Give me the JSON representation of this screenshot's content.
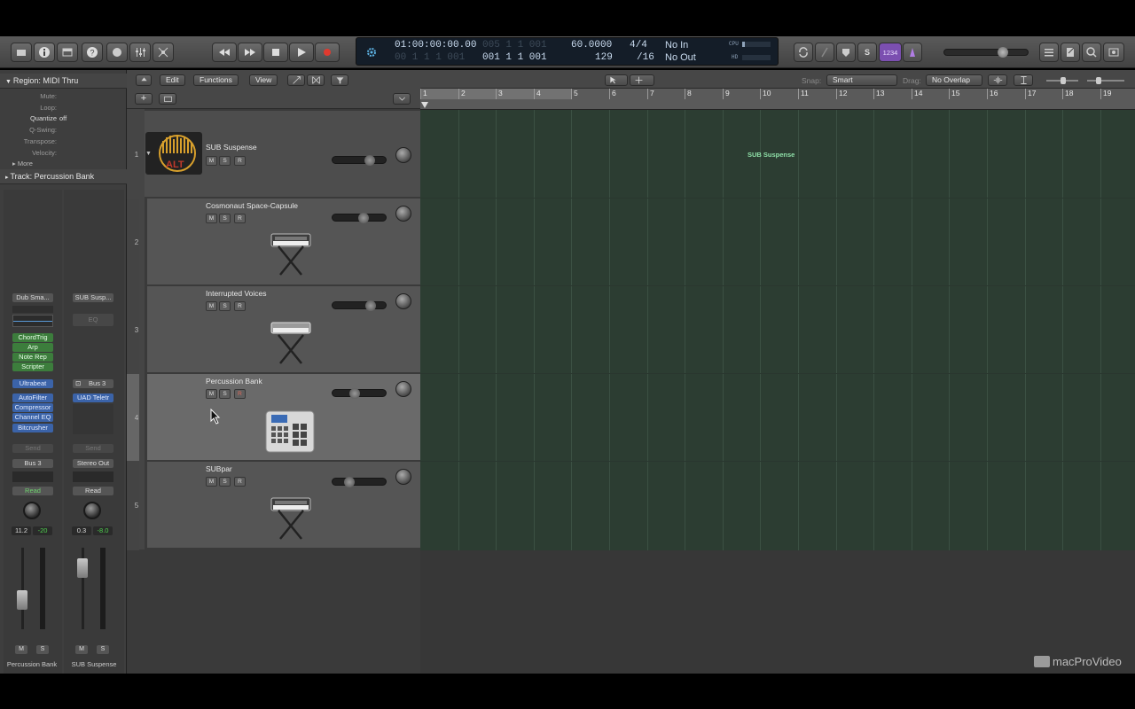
{
  "toolbar": {
    "lcd": {
      "position_time": "01:00:00:00.00",
      "position_time_dim": "00 1 1 1 001",
      "position_bars": "001 1 1 001",
      "position_bars_dim": "005 1 1 001",
      "tempo": "60.0000",
      "tempo_below": "129",
      "signature": "4/4",
      "division": "/16",
      "midi_in": "No In",
      "midi_out": "No Out",
      "cpu_label": "CPU",
      "hd_label": "HD"
    },
    "count_in_label": "1234"
  },
  "inspector": {
    "region_header": "Region: MIDI Thru",
    "params": [
      {
        "label": "Mute:",
        "value": ""
      },
      {
        "label": "Loop:",
        "value": ""
      },
      {
        "label": "Quantize",
        "value": "off"
      },
      {
        "label": "Q-Swing:",
        "value": ""
      },
      {
        "label": "Transpose:",
        "value": ""
      },
      {
        "label": "Velocity:",
        "value": ""
      }
    ],
    "more_label": "More",
    "track_header": "Track:  Percussion Bank",
    "strips": [
      {
        "setting": "Dub Sma...",
        "midi_fx": [
          "ChordTrig",
          "Arp",
          "Note Rep",
          "Scripter"
        ],
        "instrument": "Ultrabeat",
        "audio_fx": [
          "AutoFilter",
          "Compressor",
          "Channel EQ",
          "Bitcrusher"
        ],
        "send": "Send",
        "output": "Bus 3",
        "automation": "Read",
        "volume": "11.2",
        "peak": "-20",
        "name": "Percussion Bank"
      },
      {
        "setting": "SUB Susp...",
        "eq": "EQ",
        "input": "Bus 3",
        "audio_fx": [
          "UAD Teletr"
        ],
        "send": "Send",
        "output": "Stereo Out",
        "automation": "Read",
        "volume": "0.3",
        "peak": "-8.0",
        "name": "SUB Suspense"
      }
    ]
  },
  "tracks_header": {
    "edit": "Edit",
    "functions": "Functions",
    "view": "View",
    "snap_label": "Snap:",
    "snap_value": "Smart",
    "drag_label": "Drag:",
    "drag_value": "No Overlap"
  },
  "tracks": [
    {
      "num": "1",
      "name": "SUB Suspense",
      "volume": 0.72,
      "icon": "alt-logo-icon"
    },
    {
      "num": "2",
      "name": "Cosmonaut Space-Capsule",
      "volume": 0.58,
      "icon": "synth-keyboard-icon"
    },
    {
      "num": "3",
      "name": "Interrupted Voices",
      "volume": 0.73,
      "icon": "synth-keyboard-icon"
    },
    {
      "num": "4",
      "name": "Percussion Bank",
      "volume": 0.38,
      "icon": "drum-machine-icon"
    },
    {
      "num": "5",
      "name": "SUBpar",
      "volume": 0.25,
      "icon": "synth-keyboard-icon"
    }
  ],
  "track_button_labels": {
    "mute": "M",
    "solo": "S",
    "record": "R"
  },
  "ruler": {
    "bars": [
      "1",
      "2",
      "3",
      "4",
      "5",
      "6",
      "7",
      "8",
      "9",
      "10",
      "11",
      "12",
      "13",
      "14",
      "15",
      "16",
      "17",
      "18",
      "19"
    ]
  },
  "arrange": {
    "region_label": "SUB Suspense"
  },
  "watermark": "macProVideo"
}
